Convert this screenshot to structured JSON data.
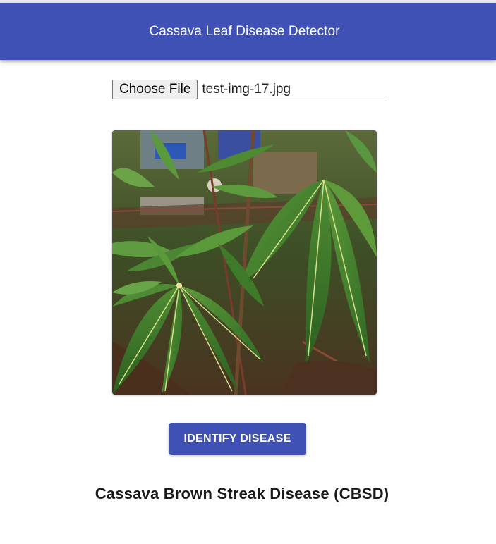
{
  "header": {
    "title": "Cassava Leaf Disease Detector",
    "background_color": "#3f51b5"
  },
  "file_input": {
    "button_label": "Choose File",
    "file_name": "test-img-17.jpg"
  },
  "image": {
    "alt": "Uploaded cassava leaf photo"
  },
  "actions": {
    "identify_label": "IDENTIFY DISEASE"
  },
  "result": {
    "prediction": "Cassava Brown Streak Disease (CBSD)"
  },
  "colors": {
    "primary": "#3f51b5",
    "text": "#1a1a1a"
  }
}
